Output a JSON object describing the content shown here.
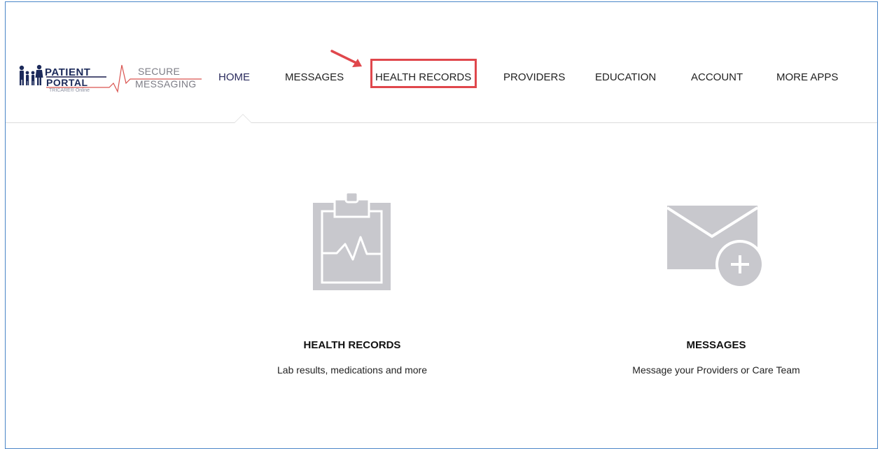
{
  "logo": {
    "line1": "PATIENT",
    "line2": "PORTAL",
    "tagline": "TRICARE® Online",
    "secure_line1": "SECURE",
    "secure_line2": "MESSAGING"
  },
  "nav": {
    "items": [
      {
        "label": "HOME",
        "active": true
      },
      {
        "label": "MESSAGES",
        "active": false
      },
      {
        "label": "HEALTH RECORDS",
        "active": false,
        "highlighted": true
      },
      {
        "label": "PROVIDERS",
        "active": false
      },
      {
        "label": "EDUCATION",
        "active": false
      },
      {
        "label": "ACCOUNT",
        "active": false
      },
      {
        "label": "MORE APPS",
        "active": false
      }
    ]
  },
  "cards": [
    {
      "title": "HEALTH RECORDS",
      "subtitle": "Lab results, medications and more",
      "icon": "clipboard-ecg-icon"
    },
    {
      "title": "MESSAGES",
      "subtitle": "Message your Providers or Care Team",
      "icon": "envelope-plus-icon"
    }
  ],
  "colors": {
    "frame_border": "#4a86c8",
    "highlight": "#e0474c",
    "icon_gray": "#c8c8cd",
    "brand_navy": "#1c2a5a",
    "ecg_red": "#d9534f"
  }
}
